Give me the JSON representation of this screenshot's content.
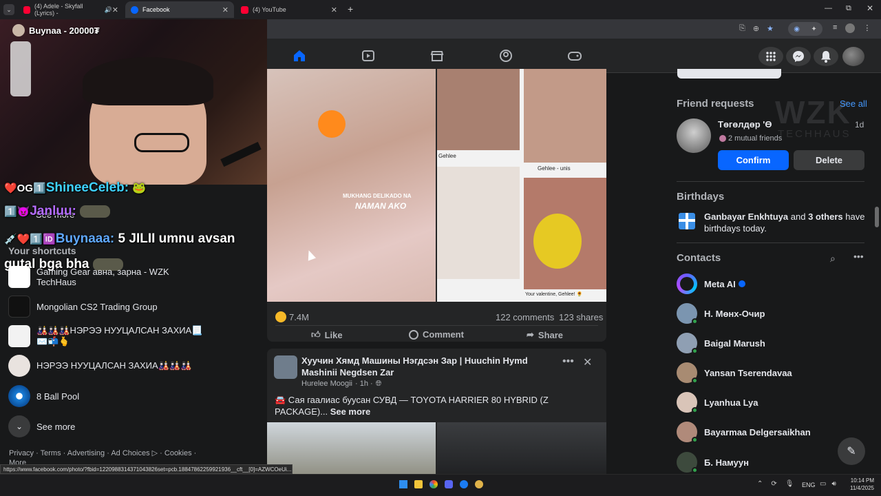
{
  "browser": {
    "tabs": [
      {
        "label": "(4) Adele - Skyfall (Lyrics) -",
        "icon": "youtube-icon"
      },
      {
        "label": "Facebook",
        "icon": "facebook-icon"
      },
      {
        "label": "(4) YouTube",
        "icon": "youtube-icon"
      }
    ],
    "status_url": "https://www.facebook.com/photo/?fbid=1220988314371043826set=pcb.18847862259921936__cft__[0]=AZWCOeUi..."
  },
  "stream": {
    "donation": "Buynaa - 20000₮",
    "chat": [
      {
        "user": "ShineeCeleb:",
        "badges": "❤️OG1️⃣",
        "msg": ""
      },
      {
        "user": "Janluu:",
        "badges": "1️⃣😈",
        "msg": ""
      },
      {
        "user": "Buynaaa:",
        "badges": "💉❤️1️⃣🆔",
        "msg": "5 JILII umnu avsan gutal bga bha"
      }
    ]
  },
  "left": {
    "see_more_top": "See more",
    "shortcuts_header": "Your shortcuts",
    "shortcuts": [
      {
        "label": "Gaming Gear авна, зарна - WZK TechHaus"
      },
      {
        "label": "Mongolian CS2 Trading Group"
      },
      {
        "label": "🎎🎎🎎НЭРЭЭ НУУЦАЛСАН ЗАХИА📃✉️📬🫰"
      },
      {
        "label": "НЭРЭЭ НУУЦАЛСАН ЗАХИА🎎🎎🎎"
      },
      {
        "label": "8 Ball Pool"
      }
    ],
    "see_more": "See more",
    "footer": "Privacy · Terms · Advertising · Ad Choices ▷ · Cookies · More"
  },
  "post1": {
    "image_caption": "MUKHANG DELIKADO NA",
    "image_caption2": "NAMAN AKO",
    "thumb_label_1": "Gehlee - unis",
    "thumb_label_2": "Gehlee",
    "thumb_label_3": "Your valentine, Gehlee! 🌻",
    "reactions": "7.4M",
    "comments": "122 comments",
    "shares": "123 shares",
    "like": "Like",
    "comment": "Comment",
    "share": "Share"
  },
  "post2": {
    "title": "Хуучин Хямд Машины Нэгдсэн Зар | Huuchin Hymd Mashinii Negdsen Zar",
    "author": "Hurelee Moogii",
    "time": "· 1h ·",
    "text": "🚘 Сая гаалиас буусан СУВД — TOYOTA HARRIER 80 HYBRID (Z PACKAGE)...",
    "see_more": "See more"
  },
  "right": {
    "friend_requests": "Friend requests",
    "see_all": "See all",
    "requester": "Төгөлдөр 'Ө",
    "request_time": "1d",
    "mutual": "2 mutual friends",
    "confirm": "Confirm",
    "delete": "Delete",
    "birthdays": "Birthdays",
    "birthday_name": "Ganbayar Enkhtuya",
    "birthday_and": "and",
    "birthday_others": "3 others",
    "birthday_rest": "have birthdays today.",
    "contacts": "Contacts",
    "contacts_list": [
      "Meta AI",
      "Н. Мөнх-Очир",
      "Baigal Marush",
      "Yansan Tserendavaa",
      "Lyanhua Lya",
      "Bayarmaa Delgersaikhan",
      "Б. Намуун"
    ]
  },
  "watermark": {
    "line1": "WZK",
    "line2": "TECHHAUS"
  },
  "taskbar": {
    "lang": "ENG",
    "time": "10:14 PM",
    "date": "11/4/2025"
  },
  "colors": {
    "fb_blue": "#0866ff",
    "online": "#31a24c"
  }
}
